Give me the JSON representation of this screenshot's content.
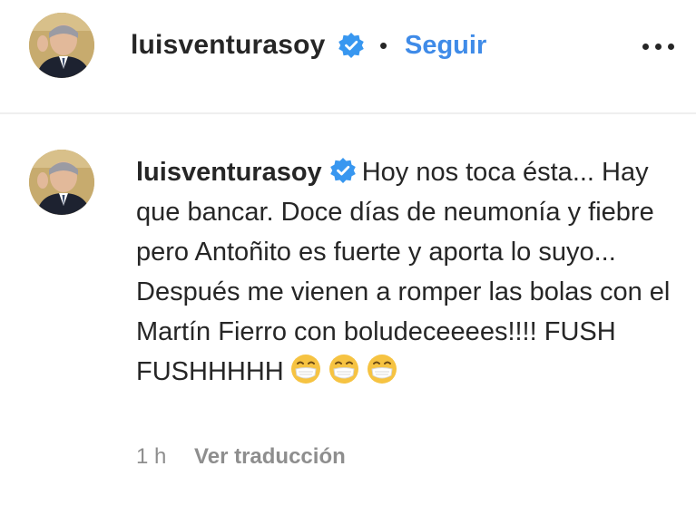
{
  "header": {
    "username": "luisventurasoy",
    "separator": "•",
    "follow_label": "Seguir",
    "more_icon": "more-horizontal-icon"
  },
  "comment": {
    "username": "luisventurasoy",
    "text": "Hoy nos toca ésta... Hay que bancar. Doce días de neumonía y fiebre pero Antoñito es fuerte y aporta lo suyo... Después me vienen a romper las bolas con el Martín Fierro con boludeceeees!!!! FUSH FUSHHHHH",
    "emojis": [
      "mask-face-emoji",
      "mask-face-emoji",
      "mask-face-emoji"
    ],
    "time": "1 h",
    "translate_label": "Ver traducción"
  },
  "colors": {
    "accent": "#3f8be8",
    "verified": "#3897f0",
    "secondary_text": "#8e8e8e",
    "divider": "#efefef"
  }
}
